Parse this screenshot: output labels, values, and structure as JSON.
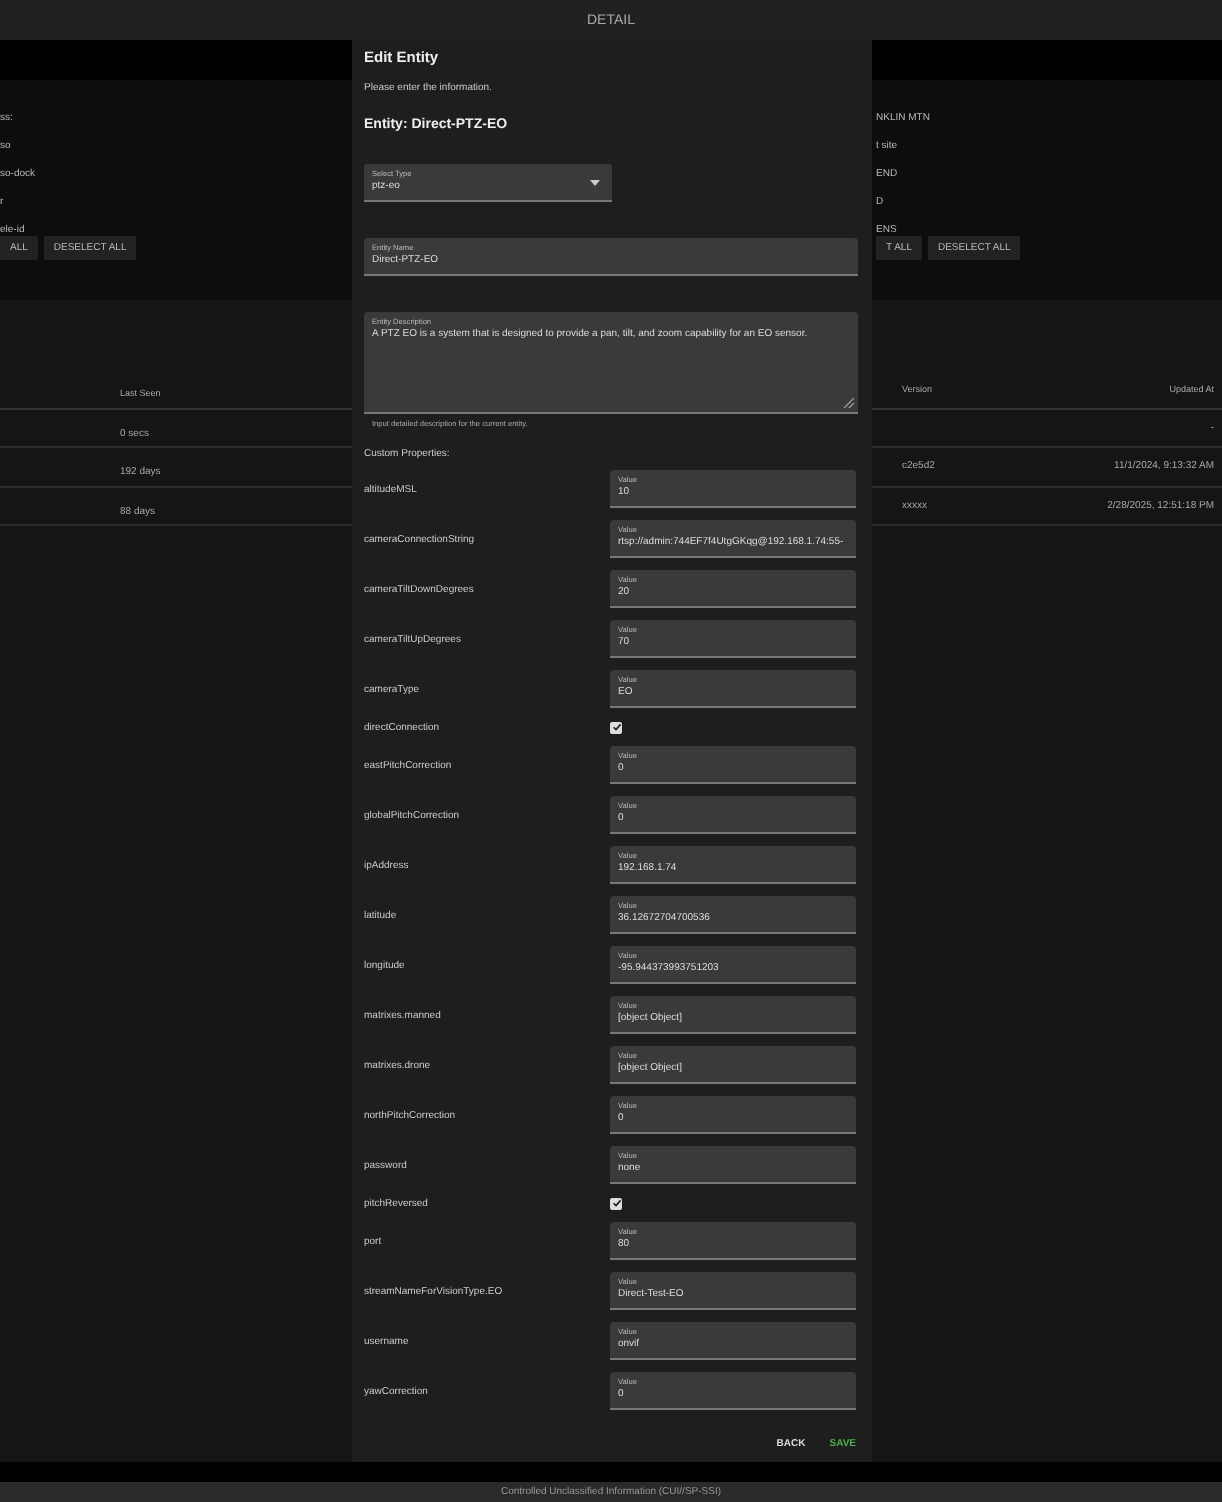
{
  "header": {
    "title": "DETAIL"
  },
  "left_panel": {
    "items": [
      "ss:",
      "so",
      "so-dock",
      "r",
      "ele-id"
    ],
    "buttons": [
      "ALL",
      "DESELECT ALL"
    ]
  },
  "right_panel": {
    "items": [
      "NKLIN MTN",
      "t site",
      "END",
      "D",
      "ENS"
    ],
    "buttons": [
      "T ALL",
      "DESELECT ALL"
    ]
  },
  "table": {
    "left_columns": [
      "Last Seen"
    ],
    "right_columns": [
      "Version",
      "Updated At"
    ],
    "rows": [
      {
        "last_seen": "0 secs",
        "updated_at": "-"
      },
      {
        "last_seen": "192 days",
        "version": "c2e5d2",
        "updated_at": "11/1/2024, 9:13:32 AM"
      },
      {
        "last_seen": "88 days",
        "version": "xxxxx",
        "updated_at": "2/28/2025, 12:51:18 PM"
      }
    ]
  },
  "dialog": {
    "title": "Edit Entity",
    "subtitle": "Please enter the information.",
    "heading": "Entity: Direct-PTZ-EO",
    "type_select": {
      "label": "Select Type",
      "value": "ptz-eo"
    },
    "name_field": {
      "label": "Entity Name",
      "value": "Direct-PTZ-EO"
    },
    "description_field": {
      "label": "Entity Description",
      "value": "A PTZ EO is a system that is designed to provide a pan, tilt, and zoom capability for an EO sensor.",
      "helper": "Input detailed description for the current entity."
    },
    "custom_properties": {
      "title": "Custom Properties:",
      "items": [
        {
          "kind": "text",
          "name": "altitudeMSL",
          "label": "Value",
          "value": "10"
        },
        {
          "kind": "text",
          "name": "cameraConnectionString",
          "label": "Value",
          "value": "rtsp://admin:744EF7f4UtgGKqg@192.168.1.74:55-"
        },
        {
          "kind": "text",
          "name": "cameraTiltDownDegrees",
          "label": "Value",
          "value": "20"
        },
        {
          "kind": "text",
          "name": "cameraTiltUpDegrees",
          "label": "Value",
          "value": "70"
        },
        {
          "kind": "text",
          "name": "cameraType",
          "label": "Value",
          "value": "EO"
        },
        {
          "kind": "checkbox",
          "name": "directConnection",
          "checked": true
        },
        {
          "kind": "text",
          "name": "eastPitchCorrection",
          "label": "Value",
          "value": "0"
        },
        {
          "kind": "text",
          "name": "globalPitchCorrection",
          "label": "Value",
          "value": "0"
        },
        {
          "kind": "text",
          "name": "ipAddress",
          "label": "Value",
          "value": "192.168.1.74"
        },
        {
          "kind": "text",
          "name": "latitude",
          "label": "Value",
          "value": "36.12672704700536"
        },
        {
          "kind": "text",
          "name": "longitude",
          "label": "Value",
          "value": "-95.944373993751203"
        },
        {
          "kind": "text",
          "name": "matrixes.manned",
          "label": "Value",
          "value": "[object Object]"
        },
        {
          "kind": "text",
          "name": "matrixes.drone",
          "label": "Value",
          "value": "[object Object]"
        },
        {
          "kind": "text",
          "name": "northPitchCorrection",
          "label": "Value",
          "value": "0"
        },
        {
          "kind": "text",
          "name": "password",
          "label": "Value",
          "value": "none"
        },
        {
          "kind": "checkbox",
          "name": "pitchReversed",
          "checked": true
        },
        {
          "kind": "text",
          "name": "port",
          "label": "Value",
          "value": "80"
        },
        {
          "kind": "text",
          "name": "streamNameForVisionType.EO",
          "label": "Value",
          "value": "Direct-Test-EO"
        },
        {
          "kind": "text",
          "name": "username",
          "label": "Value",
          "value": "onvif"
        },
        {
          "kind": "text",
          "name": "yawCorrection",
          "label": "Value",
          "value": "0"
        }
      ]
    },
    "actions": [
      {
        "label": "BACK",
        "kind": "secondary"
      },
      {
        "label": "SAVE",
        "kind": "primary"
      }
    ]
  },
  "footer": {
    "text": "Controlled Unclassified Information (CUI//SP-SSI)"
  }
}
